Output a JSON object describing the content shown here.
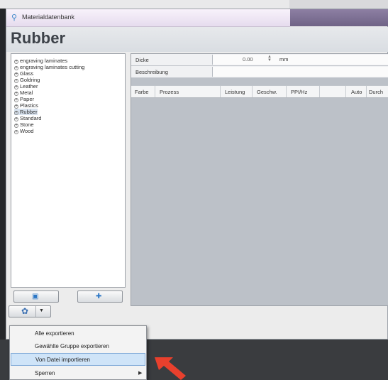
{
  "window": {
    "title": "Materialdatenbank",
    "icon": "app-icon"
  },
  "header": {
    "title": "Rubber"
  },
  "tree": {
    "items": [
      "engraving laminates",
      "engraving laminates cutting",
      "Glass",
      "Goldring",
      "Leather",
      "Metal",
      "Paper",
      "Plastics",
      "Rubber",
      "Standard",
      "Stone",
      "Wood"
    ],
    "selected": "Rubber"
  },
  "tree_buttons": {
    "left_icon": "import-icon",
    "right_icon": "add-icon"
  },
  "properties": {
    "dicke_label": "Dicke",
    "dicke_value": "0.00",
    "dicke_unit": "mm",
    "beschreibung_label": "Beschreibung",
    "beschreibung_value": ""
  },
  "grid": {
    "columns": [
      "Farbe",
      "Prozess",
      "Leistung",
      "Geschw.",
      "PPI/Hz",
      "Auto",
      "Durch"
    ]
  },
  "toolbar": {
    "gear_icon": "gear-icon",
    "chevron_icon": "chevron-down-icon"
  },
  "menu": {
    "items": [
      {
        "label": "Alle exportieren"
      },
      {
        "label": "Gewählte Gruppe exportieren"
      },
      {
        "label": "Von Datei importieren",
        "highlighted": true
      },
      {
        "label": "Sperren",
        "submenu": true
      }
    ]
  },
  "colors": {
    "highlight": "#cfe4f8",
    "arrow": "#e8402d",
    "accent": "#2c77c6"
  }
}
